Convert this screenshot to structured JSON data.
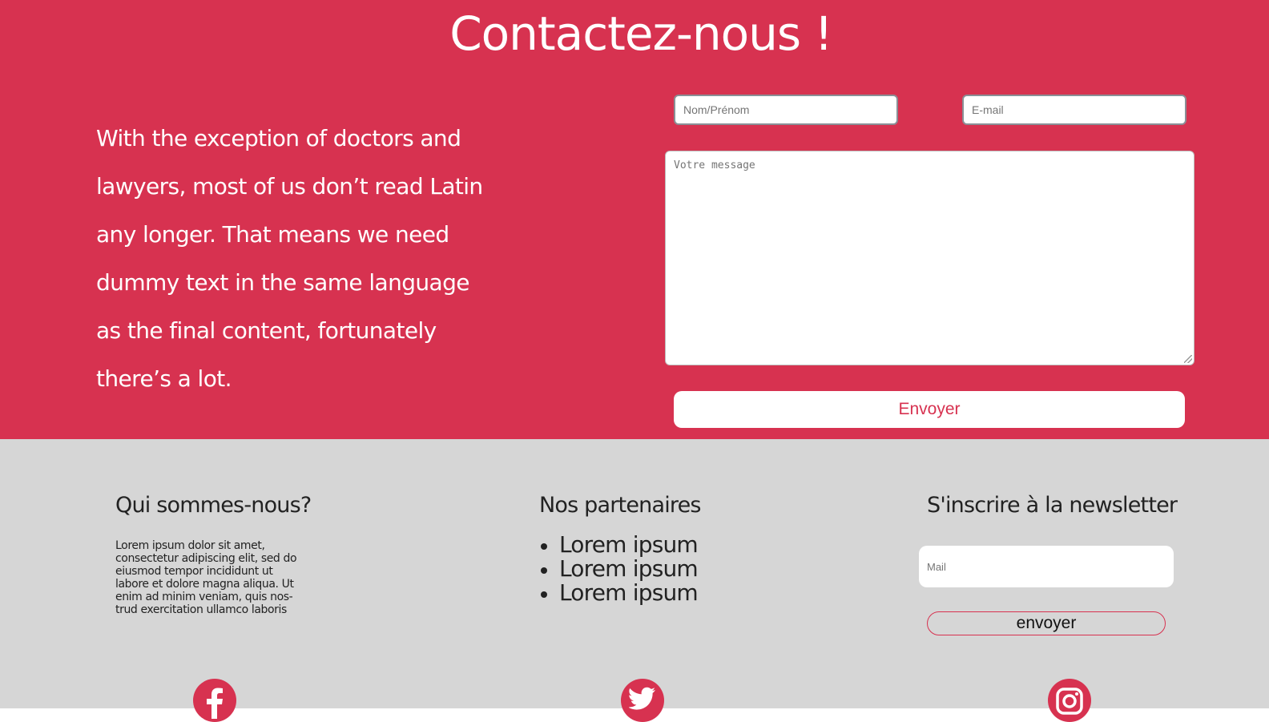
{
  "contact": {
    "title": "Contactez-nous !",
    "intro": "With the exception of doctors and lawyers, most of us don’t read Latin any longer. That means we need dummy text in the same language as the final content, fortunately there’s a lot.",
    "name_placeholder": "Nom/Prénom",
    "email_placeholder": "E-mail",
    "message_placeholder": "Votre message",
    "send_label": "Envoyer"
  },
  "footer": {
    "about_title": "Qui sommes-nous?",
    "about_text": "Lorem ipsum dolor sit amet, consectetur adipiscing elit, sed do eiusmod tempor incididunt ut labore et dolore magna aliqua. Ut enim ad minim veniam, quis nos- trud exercitation ullamco laboris",
    "partners_title": "Nos partenaires",
    "partners": [
      "Lorem ipsum",
      "Lorem ipsum",
      "Lorem ipsum"
    ],
    "newsletter_title": "S'inscrire à la newsletter",
    "newsletter_placeholder": "Mail",
    "newsletter_button": "envoyer"
  },
  "social": {
    "icons": [
      "facebook-icon",
      "twitter-icon",
      "instagram-icon"
    ]
  },
  "colors": {
    "brand": "#d73250",
    "footer_bg": "#d6d6d6",
    "white": "#ffffff"
  }
}
